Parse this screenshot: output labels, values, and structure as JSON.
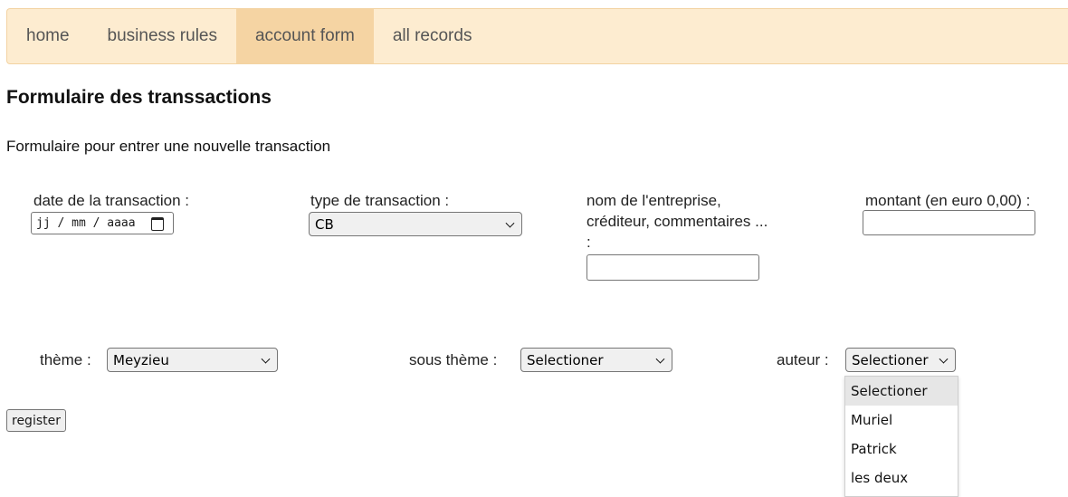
{
  "nav": [
    {
      "label": "home",
      "active": false
    },
    {
      "label": "business rules",
      "active": false
    },
    {
      "label": "account form",
      "active": true
    },
    {
      "label": "all records",
      "active": false
    }
  ],
  "title": "Formulaire des transsactions",
  "subtitle": "Formulaire pour entrer une nouvelle transaction",
  "fields": {
    "date": {
      "label": "date de la transaction :",
      "placeholder": "jj / mm / aaaa"
    },
    "type": {
      "label": "type de transaction :",
      "value": "CB"
    },
    "nom": {
      "label_line1": "nom de l'entreprise,",
      "label_line2": "créditeur, commentaires ...",
      "label_line3": ":",
      "value": ""
    },
    "montant": {
      "label": "montant (en euro 0,00) :",
      "value": ""
    },
    "theme": {
      "label": "thème :",
      "value": "Meyzieu"
    },
    "sous_theme": {
      "label": "sous thème :",
      "value": "Selectioner"
    },
    "auteur": {
      "label": "auteur :",
      "value": "Selectioner",
      "options": [
        "Selectioner",
        "Muriel",
        "Patrick",
        "les deux"
      ],
      "highlighted": "Selectioner"
    }
  },
  "register_label": "register",
  "colors": {
    "nav_bg": "#fdecd0",
    "nav_active": "#f5d4a3",
    "nav_border": "#f3d3a2"
  }
}
